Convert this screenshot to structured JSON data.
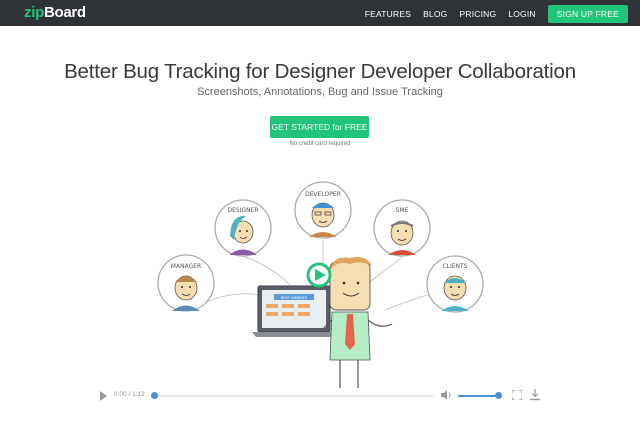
{
  "nav": {
    "logo_prefix": "zip",
    "logo_suffix": "Board",
    "links": [
      "FEATURES",
      "BLOG",
      "PRICING",
      "LOGIN"
    ],
    "signup_label": "SIGN UP FREE"
  },
  "hero": {
    "headline": "Better Bug Tracking for Designer Developer Collaboration",
    "subheadline": "Screenshots, Annotations, Bug and Issue Tracking",
    "cta_label": "GET STARTED for FREE",
    "cta_note": "No credit card required"
  },
  "illustration": {
    "roles": [
      "MANAGER",
      "DESIGNER",
      "DEVELOPER",
      "SME",
      "CLIENTS"
    ],
    "laptop_banner": "BEST WEBSITE"
  },
  "player": {
    "time": "0:00 / 1:12",
    "progress": 0,
    "volume": 1.0
  },
  "colors": {
    "nav_bg": "#2f3338",
    "accent_green": "#21c47a",
    "player_blue": "#4a90d9"
  }
}
